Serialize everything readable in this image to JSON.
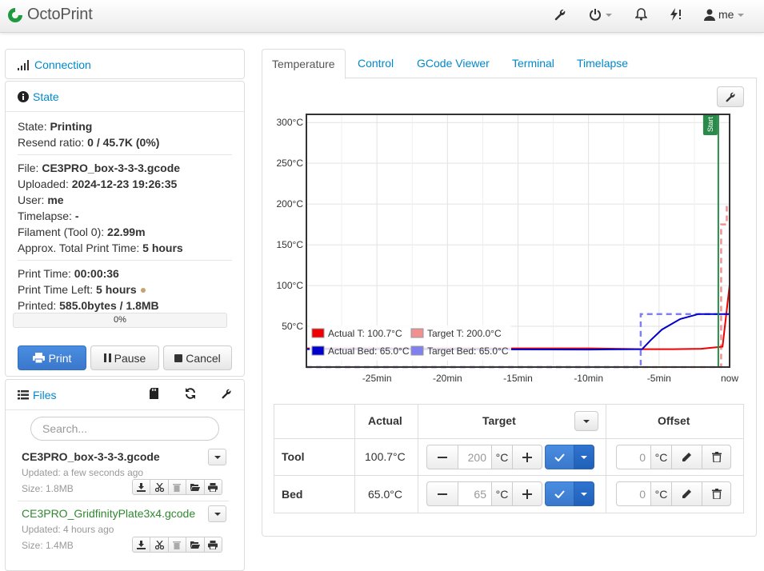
{
  "navbar": {
    "brand": "OctoPrint",
    "user": "me"
  },
  "connection": {
    "title": "Connection"
  },
  "state": {
    "title": "State",
    "state_label": "State: ",
    "state_value": "Printing",
    "resend_label": "Resend ratio: ",
    "resend_value": "0 / 45.7K (0%)",
    "file_label": "File: ",
    "file_value": "CE3PRO_box-3-3-3.gcode",
    "uploaded_label": "Uploaded: ",
    "uploaded_value": "2024-12-23 19:26:35",
    "user_label": "User: ",
    "user_value": "me",
    "timelapse_label": "Timelapse: ",
    "timelapse_value": "-",
    "filament_label": "Filament (Tool 0): ",
    "filament_value": "22.99m",
    "approx_label": "Approx. Total Print Time: ",
    "approx_value": "5 hours",
    "printtime_label": "Print Time: ",
    "printtime_value": "00:00:36",
    "timeleft_label": "Print Time Left: ",
    "timeleft_value": "5 hours",
    "printed_label": "Printed: ",
    "printed_value": "585.0bytes / 1.8MB",
    "progress_text": "0%",
    "progress_fraction": 0.0,
    "print_btn": "Print",
    "pause_btn": "Pause",
    "cancel_btn": "Cancel"
  },
  "files": {
    "title": "Files",
    "search_placeholder": "Search...",
    "items": [
      {
        "name": "CE3PRO_box-3-3-3.gcode",
        "updated": "Updated: a few seconds ago",
        "size": "Size: 1.8MB"
      },
      {
        "name": "CE3PRO_GridfinityPlate3x4.gcode",
        "updated": "Updated: 4 hours ago",
        "size": "Size: 1.4MB"
      }
    ]
  },
  "tabs": [
    "Temperature",
    "Control",
    "GCode Viewer",
    "Terminal",
    "Timelapse"
  ],
  "chart_data": {
    "type": "line",
    "x_ticks": [
      "-25min",
      "-20min",
      "-15min",
      "-10min",
      "-5min",
      "now"
    ],
    "y_ticks": [
      "50°C",
      "100°C",
      "150°C",
      "200°C",
      "250°C",
      "300°C"
    ],
    "ylim": [
      0,
      310
    ],
    "xlim_min": [
      -30,
      0
    ],
    "marker_label": "Start",
    "marker_x_min": -0.8,
    "series": [
      {
        "name": "Actual T: 100.7°C",
        "color": "#ee0000",
        "style": "solid",
        "x": [
          -30,
          -20,
          -10,
          -6.2,
          -4,
          -2,
          -0.5,
          0
        ],
        "y": [
          23,
          23,
          23,
          22,
          22,
          22.5,
          25,
          100.7
        ]
      },
      {
        "name": "Target T: 200.0°C",
        "color": "#f09090",
        "style": "dashed",
        "x": [
          -30,
          -1.0,
          -0.6,
          -0.6,
          -0.2,
          -0.2,
          0
        ],
        "y": [
          0,
          0,
          0,
          175,
          175,
          200,
          200
        ]
      },
      {
        "name": "Actual Bed: 65.0°C",
        "color": "#0000cc",
        "style": "solid",
        "x": [
          -30,
          -20,
          -10,
          -6.2,
          -5.6,
          -4.8,
          -3.5,
          -2.2,
          0
        ],
        "y": [
          22,
          22,
          21.5,
          22,
          33,
          46,
          59,
          65,
          65
        ]
      },
      {
        "name": "Target Bed: 65.0°C",
        "color": "#8080ee",
        "style": "dashed",
        "x": [
          -30,
          -6.3,
          -6.3,
          0
        ],
        "y": [
          0,
          0,
          65,
          65
        ]
      }
    ]
  },
  "temp_table": {
    "headers": {
      "actual": "Actual",
      "target": "Target",
      "offset": "Offset"
    },
    "unit": "°C",
    "rows": [
      {
        "label": "Tool",
        "actual": "100.7°C",
        "target": "200",
        "offset": "0"
      },
      {
        "label": "Bed",
        "actual": "65.0°C",
        "target": "65",
        "offset": "0"
      }
    ]
  },
  "colors": {
    "accent": "#0088cc",
    "primary_btn": "#428bca",
    "start_marker": "#2a8a4a"
  }
}
